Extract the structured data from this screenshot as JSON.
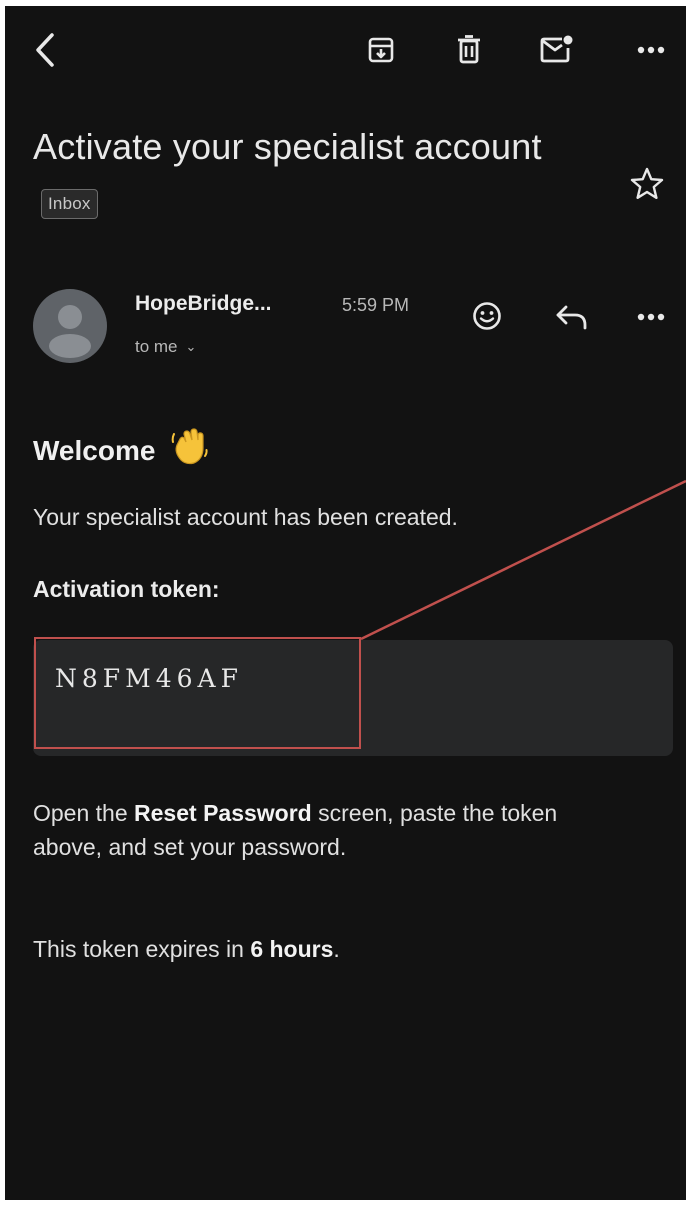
{
  "toolbar": {
    "back_icon": "back-chevron-icon",
    "archive_icon": "archive-icon",
    "delete_icon": "trash-icon",
    "mark_unread_icon": "mark-unread-icon",
    "more_icon": "more-horizontal-icon"
  },
  "email": {
    "subject": "Activate your specialist account",
    "label_chip": "Inbox",
    "sender": "HopeBridge...",
    "time": "5:59 PM",
    "recipient": "to me",
    "recipient_chevron": "⌄"
  },
  "body": {
    "welcome": "Welcome",
    "created_line": "Your specialist account has been created.",
    "token_label": "Activation token:",
    "token_value": "N8FM46AF",
    "instructions_1": "Open the ",
    "instructions_bold": "Reset Password",
    "instructions_2": " screen, paste the token above, and set your password.",
    "expires_1": "This token expires in ",
    "expires_bold": "6 hours",
    "expires_2": "."
  },
  "colors": {
    "background": "#121212",
    "token_box": "#262728",
    "highlight": "#c0504d",
    "text": "#e3e3e3"
  }
}
